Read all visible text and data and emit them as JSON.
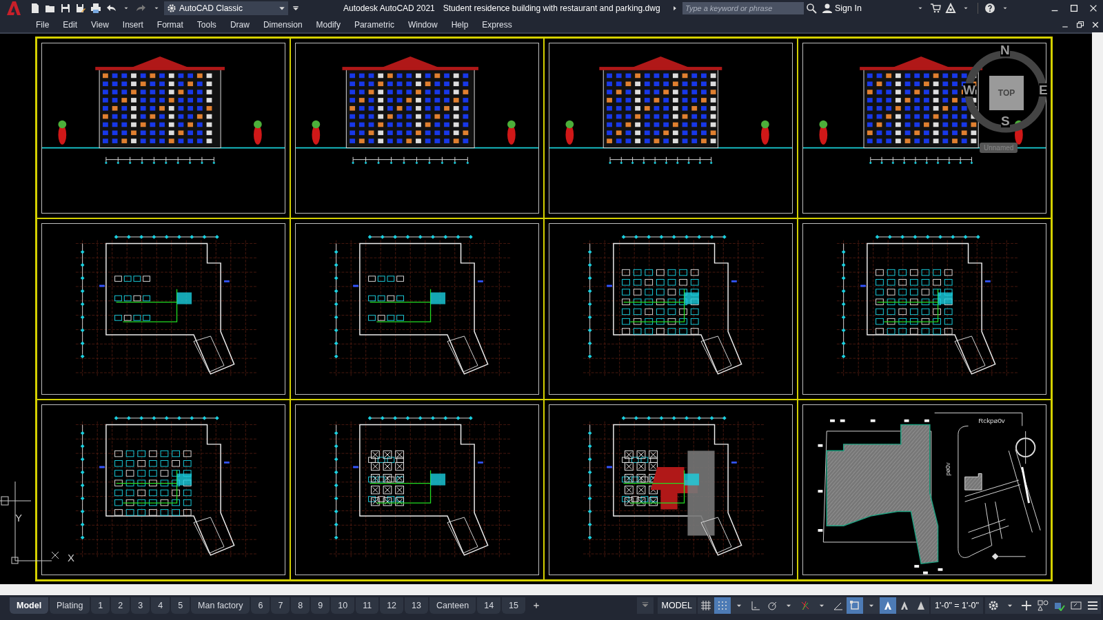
{
  "window": {
    "app": "Autodesk AutoCAD 2021",
    "document": "Student residence building with restaurant and parking.dwg"
  },
  "workspace": "AutoCAD Classic",
  "search": {
    "placeholder": "Type a keyword or phrase"
  },
  "account": {
    "label": "Sign In"
  },
  "menu": [
    "File",
    "Edit",
    "View",
    "Insert",
    "Format",
    "Tools",
    "Draw",
    "Dimension",
    "Modify",
    "Parametric",
    "Window",
    "Help",
    "Express"
  ],
  "sheets": [
    {
      "kind": "elevation"
    },
    {
      "kind": "elevation"
    },
    {
      "kind": "elevation"
    },
    {
      "kind": "elevation"
    },
    {
      "kind": "plan"
    },
    {
      "kind": "plan"
    },
    {
      "kind": "plan"
    },
    {
      "kind": "plan"
    },
    {
      "kind": "plan"
    },
    {
      "kind": "plan"
    },
    {
      "kind": "plan"
    },
    {
      "kind": "site",
      "labels": [
        "Rckpø0v",
        "pø0v"
      ]
    }
  ],
  "viewcube": {
    "north": "N",
    "south": "S",
    "east": "E",
    "west": "W",
    "face": "TOP",
    "named_view": "Unnamed"
  },
  "ucs": {
    "y": "Y",
    "x": "X"
  },
  "layout_tabs": [
    {
      "label": "Model",
      "selected": true
    },
    {
      "label": "Plating",
      "selected": false
    },
    {
      "label": "1",
      "selected": false
    },
    {
      "label": "2",
      "selected": false
    },
    {
      "label": "3",
      "selected": false
    },
    {
      "label": "4",
      "selected": false
    },
    {
      "label": "5",
      "selected": false
    },
    {
      "label": "Man factory",
      "selected": false
    },
    {
      "label": "6",
      "selected": false
    },
    {
      "label": "7",
      "selected": false
    },
    {
      "label": "8",
      "selected": false
    },
    {
      "label": "9",
      "selected": false
    },
    {
      "label": "10",
      "selected": false
    },
    {
      "label": "11",
      "selected": false
    },
    {
      "label": "12",
      "selected": false
    },
    {
      "label": "13",
      "selected": false
    },
    {
      "label": "Canteen",
      "selected": false
    },
    {
      "label": "14",
      "selected": false
    },
    {
      "label": "15",
      "selected": false
    }
  ],
  "status_bar": {
    "space": "MODEL",
    "scale": "1'-0\" = 1'-0\"",
    "toggles": [
      {
        "kind": "grid",
        "on": false
      },
      {
        "kind": "snap",
        "on": true
      },
      {
        "kind": "ortho",
        "on": false
      },
      {
        "kind": "polar",
        "on": false
      },
      {
        "kind": "isodraft",
        "on": false
      },
      {
        "kind": "angle",
        "on": false
      },
      {
        "kind": "osnap",
        "on": true
      },
      {
        "kind": "annovis",
        "on": true
      },
      {
        "kind": "autoscale",
        "on": false
      },
      {
        "kind": "annoscale",
        "on": false
      }
    ]
  }
}
